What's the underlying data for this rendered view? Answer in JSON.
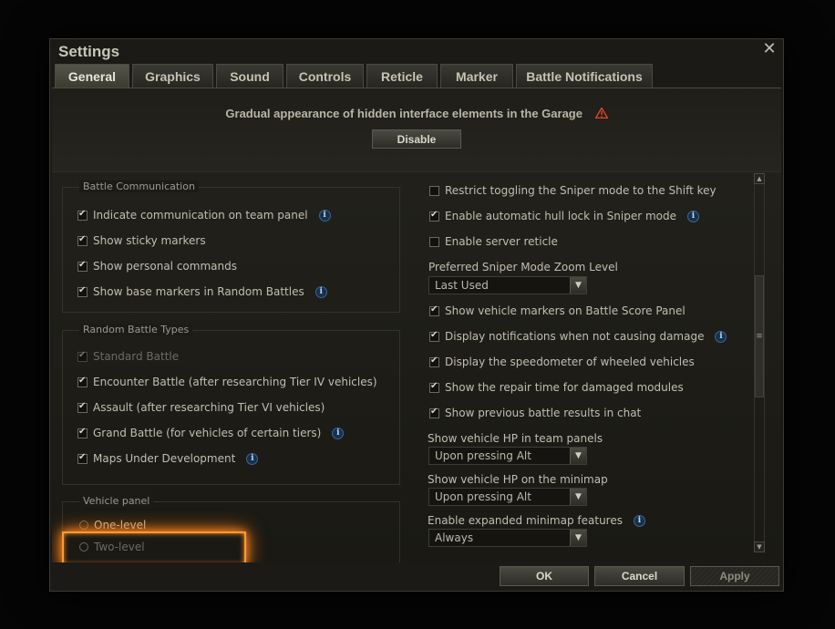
{
  "window": {
    "title": "Settings"
  },
  "tabs": [
    {
      "label": "General",
      "active": true
    },
    {
      "label": "Graphics"
    },
    {
      "label": "Sound"
    },
    {
      "label": "Controls"
    },
    {
      "label": "Reticle"
    },
    {
      "label": "Marker"
    },
    {
      "label": "Battle Notifications"
    }
  ],
  "banner": {
    "text": "Gradual appearance of hidden interface elements in the Garage",
    "button": "Disable",
    "warning_color": "#e0452a"
  },
  "left": {
    "battle_communication": {
      "title": "Battle Communication",
      "items": [
        {
          "label": "Indicate communication on team panel",
          "checked": true,
          "info": true
        },
        {
          "label": "Show sticky markers",
          "checked": true
        },
        {
          "label": "Show personal commands",
          "checked": true
        },
        {
          "label": "Show base markers in Random Battles",
          "checked": true,
          "info": true
        }
      ]
    },
    "random_battle_types": {
      "title": "Random Battle Types",
      "items": [
        {
          "label": "Standard Battle",
          "checked": true,
          "disabled": true
        },
        {
          "label": "Encounter Battle (after researching Tier IV vehicles)",
          "checked": true
        },
        {
          "label": "Assault (after researching Tier VI vehicles)",
          "checked": true
        },
        {
          "label": "Grand Battle (for vehicles of certain tiers)",
          "checked": true,
          "info": true
        },
        {
          "label": "Maps Under Development",
          "checked": true,
          "info": true,
          "highlighted": true
        }
      ]
    },
    "vehicle_panel": {
      "title": "Vehicle panel",
      "options": [
        {
          "label": "One-level"
        },
        {
          "label": "Two-level"
        }
      ]
    }
  },
  "right": {
    "items": [
      {
        "label": "Restrict toggling the Sniper mode to the Shift key",
        "checked": false
      },
      {
        "label": "Enable automatic hull lock in Sniper mode",
        "checked": true,
        "info": true
      },
      {
        "label": "Enable server reticle",
        "checked": false
      }
    ],
    "zoom": {
      "label": "Preferred Sniper Mode Zoom Level",
      "value": "Last Used"
    },
    "items2": [
      {
        "label": "Show vehicle markers on Battle Score Panel",
        "checked": true
      },
      {
        "label": "Display notifications when not causing damage",
        "checked": true,
        "info": true
      },
      {
        "label": "Display the speedometer of wheeled vehicles",
        "checked": true
      },
      {
        "label": "Show the repair time for damaged modules",
        "checked": true
      },
      {
        "label": "Show previous battle results in chat",
        "checked": true
      }
    ],
    "hp_team": {
      "label": "Show vehicle HP in team panels",
      "value": "Upon pressing Alt"
    },
    "hp_minimap": {
      "label": "Show vehicle HP on the minimap",
      "value": "Upon pressing Alt"
    },
    "minimap": {
      "label": "Enable expanded minimap features",
      "value": "Always"
    }
  },
  "footer": {
    "ok": "OK",
    "cancel": "Cancel",
    "apply": "Apply"
  },
  "colors": {
    "highlight": "#ff9a32",
    "info": "#3d6590"
  }
}
